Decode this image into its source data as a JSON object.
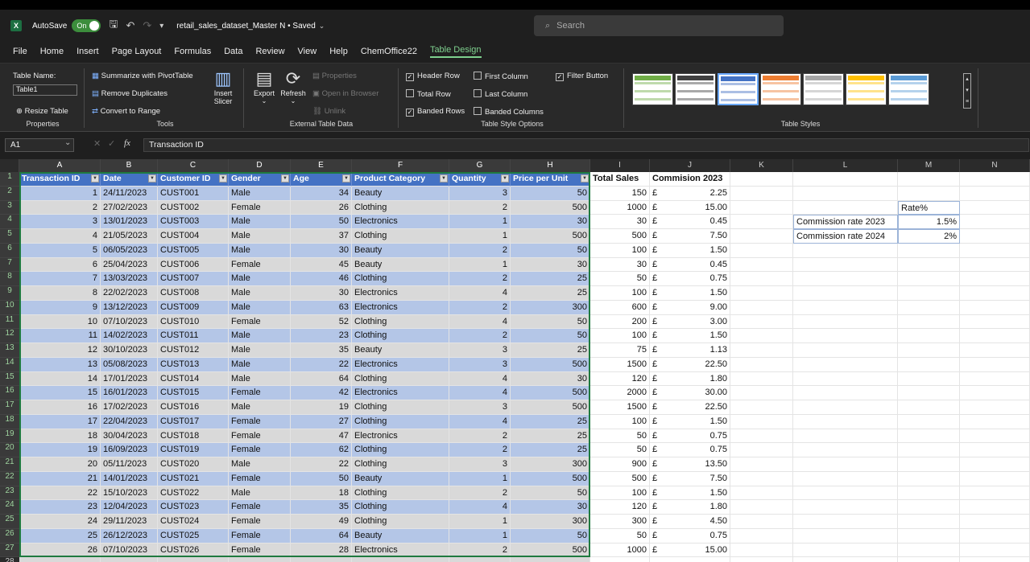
{
  "titlebar": {
    "logo": "X",
    "autosave_label": "AutoSave",
    "toggle_state": "On",
    "file_title": "retail_sales_dataset_Master N • Saved",
    "search_placeholder": "Search"
  },
  "menu": [
    "File",
    "Home",
    "Insert",
    "Page Layout",
    "Formulas",
    "Data",
    "Review",
    "View",
    "Help",
    "ChemOffice22",
    "Table Design"
  ],
  "menu_active": "Table Design",
  "ribbon": {
    "properties": {
      "table_name_label": "Table Name:",
      "table_name": "Table1",
      "resize": "Resize Table",
      "group": "Properties"
    },
    "tools": {
      "summarize": "Summarize with PivotTable",
      "remove_dup": "Remove Duplicates",
      "convert": "Convert to Range",
      "insert_slicer_1": "Insert",
      "insert_slicer_2": "Slicer",
      "group": "Tools"
    },
    "external": {
      "export": "Export",
      "refresh": "Refresh",
      "properties": "Properties",
      "open_browser": "Open in Browser",
      "unlink": "Unlink",
      "group": "External Table Data"
    },
    "options": {
      "header_row": "Header Row",
      "total_row": "Total Row",
      "banded_rows": "Banded Rows",
      "first_column": "First Column",
      "last_column": "Last Column",
      "banded_columns": "Banded Columns",
      "filter_button": "Filter Button",
      "group": "Table Style Options"
    },
    "styles": {
      "group": "Table Styles",
      "swatch_colors": [
        "#70ad47",
        "#404040",
        "#4472c4",
        "#ed7d31",
        "#a5a5a5",
        "#ffc000",
        "#5b9bd5"
      ]
    }
  },
  "formula_bar": {
    "name_box": "A1",
    "fx": "fx",
    "content": "Transaction ID"
  },
  "columns": [
    "A",
    "B",
    "C",
    "D",
    "E",
    "F",
    "G",
    "H",
    "I",
    "J",
    "K",
    "L",
    "M",
    "N"
  ],
  "headers": [
    "Transaction ID",
    "Date",
    "Customer ID",
    "Gender",
    "Age",
    "Product Category",
    "Quantity",
    "Price per Unit",
    "Total Sales",
    "Commision 2023"
  ],
  "rows": [
    [
      "1",
      "24/11/2023",
      "CUST001",
      "Male",
      "34",
      "Beauty",
      "3",
      "50",
      "150",
      "£",
      "2.25"
    ],
    [
      "2",
      "27/02/2023",
      "CUST002",
      "Female",
      "26",
      "Clothing",
      "2",
      "500",
      "1000",
      "£",
      "15.00"
    ],
    [
      "3",
      "13/01/2023",
      "CUST003",
      "Male",
      "50",
      "Electronics",
      "1",
      "30",
      "30",
      "£",
      "0.45"
    ],
    [
      "4",
      "21/05/2023",
      "CUST004",
      "Male",
      "37",
      "Clothing",
      "1",
      "500",
      "500",
      "£",
      "7.50"
    ],
    [
      "5",
      "06/05/2023",
      "CUST005",
      "Male",
      "30",
      "Beauty",
      "2",
      "50",
      "100",
      "£",
      "1.50"
    ],
    [
      "6",
      "25/04/2023",
      "CUST006",
      "Female",
      "45",
      "Beauty",
      "1",
      "30",
      "30",
      "£",
      "0.45"
    ],
    [
      "7",
      "13/03/2023",
      "CUST007",
      "Male",
      "46",
      "Clothing",
      "2",
      "25",
      "50",
      "£",
      "0.75"
    ],
    [
      "8",
      "22/02/2023",
      "CUST008",
      "Male",
      "30",
      "Electronics",
      "4",
      "25",
      "100",
      "£",
      "1.50"
    ],
    [
      "9",
      "13/12/2023",
      "CUST009",
      "Male",
      "63",
      "Electronics",
      "2",
      "300",
      "600",
      "£",
      "9.00"
    ],
    [
      "10",
      "07/10/2023",
      "CUST010",
      "Female",
      "52",
      "Clothing",
      "4",
      "50",
      "200",
      "£",
      "3.00"
    ],
    [
      "11",
      "14/02/2023",
      "CUST011",
      "Male",
      "23",
      "Clothing",
      "2",
      "50",
      "100",
      "£",
      "1.50"
    ],
    [
      "12",
      "30/10/2023",
      "CUST012",
      "Male",
      "35",
      "Beauty",
      "3",
      "25",
      "75",
      "£",
      "1.13"
    ],
    [
      "13",
      "05/08/2023",
      "CUST013",
      "Male",
      "22",
      "Electronics",
      "3",
      "500",
      "1500",
      "£",
      "22.50"
    ],
    [
      "14",
      "17/01/2023",
      "CUST014",
      "Male",
      "64",
      "Clothing",
      "4",
      "30",
      "120",
      "£",
      "1.80"
    ],
    [
      "15",
      "16/01/2023",
      "CUST015",
      "Female",
      "42",
      "Electronics",
      "4",
      "500",
      "2000",
      "£",
      "30.00"
    ],
    [
      "16",
      "17/02/2023",
      "CUST016",
      "Male",
      "19",
      "Clothing",
      "3",
      "500",
      "1500",
      "£",
      "22.50"
    ],
    [
      "17",
      "22/04/2023",
      "CUST017",
      "Female",
      "27",
      "Clothing",
      "4",
      "25",
      "100",
      "£",
      "1.50"
    ],
    [
      "18",
      "30/04/2023",
      "CUST018",
      "Female",
      "47",
      "Electronics",
      "2",
      "25",
      "50",
      "£",
      "0.75"
    ],
    [
      "19",
      "16/09/2023",
      "CUST019",
      "Female",
      "62",
      "Clothing",
      "2",
      "25",
      "50",
      "£",
      "0.75"
    ],
    [
      "20",
      "05/11/2023",
      "CUST020",
      "Male",
      "22",
      "Clothing",
      "3",
      "300",
      "900",
      "£",
      "13.50"
    ],
    [
      "21",
      "14/01/2023",
      "CUST021",
      "Female",
      "50",
      "Beauty",
      "1",
      "500",
      "500",
      "£",
      "7.50"
    ],
    [
      "22",
      "15/10/2023",
      "CUST022",
      "Male",
      "18",
      "Clothing",
      "2",
      "50",
      "100",
      "£",
      "1.50"
    ],
    [
      "23",
      "12/04/2023",
      "CUST023",
      "Female",
      "35",
      "Clothing",
      "4",
      "30",
      "120",
      "£",
      "1.80"
    ],
    [
      "24",
      "29/11/2023",
      "CUST024",
      "Female",
      "49",
      "Clothing",
      "1",
      "300",
      "300",
      "£",
      "4.50"
    ],
    [
      "25",
      "26/12/2023",
      "CUST025",
      "Female",
      "64",
      "Beauty",
      "1",
      "50",
      "50",
      "£",
      "0.75"
    ],
    [
      "26",
      "07/10/2023",
      "CUST026",
      "Female",
      "28",
      "Electronics",
      "2",
      "500",
      "1000",
      "£",
      "15.00"
    ]
  ],
  "side_table": {
    "rate_label": "Rate%",
    "r2023_label": "Commission rate 2023",
    "r2023_value": "1.5%",
    "r2024_label": "Commission rate 2024",
    "r2024_value": "2%"
  }
}
